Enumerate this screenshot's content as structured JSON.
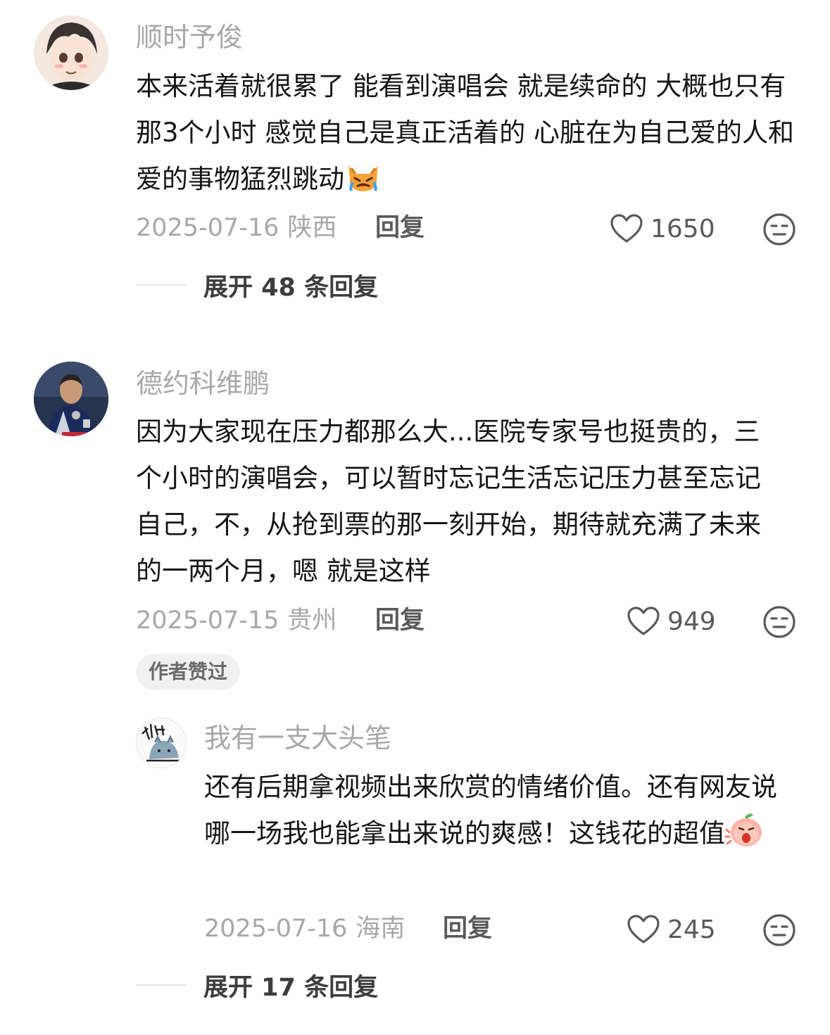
{
  "comments": [
    {
      "username": "顺时予俊",
      "text": "本来活着就很累了 能看到演唱会 就是续命的 大概也只有那3个小时 感觉自己是真正活着的 心脏在为自己爱的人和爱的事物猛烈跳动",
      "emoji": "crying-cat-emoji",
      "date": "2025-07-16",
      "location": "陕西",
      "reply_label": "回复",
      "likes": "1650",
      "expand_label": "展开 48 条回复"
    },
    {
      "username": "德约科维鹏",
      "text": "因为大家现在压力都那么大...医院专家号也挺贵的，三个小时的演唱会，可以暂时忘记生活忘记压力甚至忘记自己，不，从抢到票的那一刻开始，期待就充满了未来的一两个月，嗯 就是这样",
      "date": "2025-07-15",
      "location": "贵州",
      "reply_label": "回复",
      "likes": "949",
      "author_badge": "作者赞过",
      "reply": {
        "username": "我有一支大头笔",
        "text": "还有后期拿视频出来欣赏的情绪价值。还有网友说哪一场我也能拿出来说的爽感！这钱花的超值",
        "emoji": "shocked-peach-emoji",
        "date": "2025-07-16",
        "location": "海南",
        "reply_label": "回复",
        "likes": "245"
      },
      "expand_label": "展开 17 条回复"
    }
  ],
  "colors": {
    "username": "#a8a8a8",
    "text": "#161616",
    "meta": "#a8a8a8",
    "action": "#5a5a5a",
    "badge_bg": "#f1f1f1"
  },
  "icons": {
    "like": "heart-outline-icon",
    "dislike": "meh-face-icon"
  }
}
